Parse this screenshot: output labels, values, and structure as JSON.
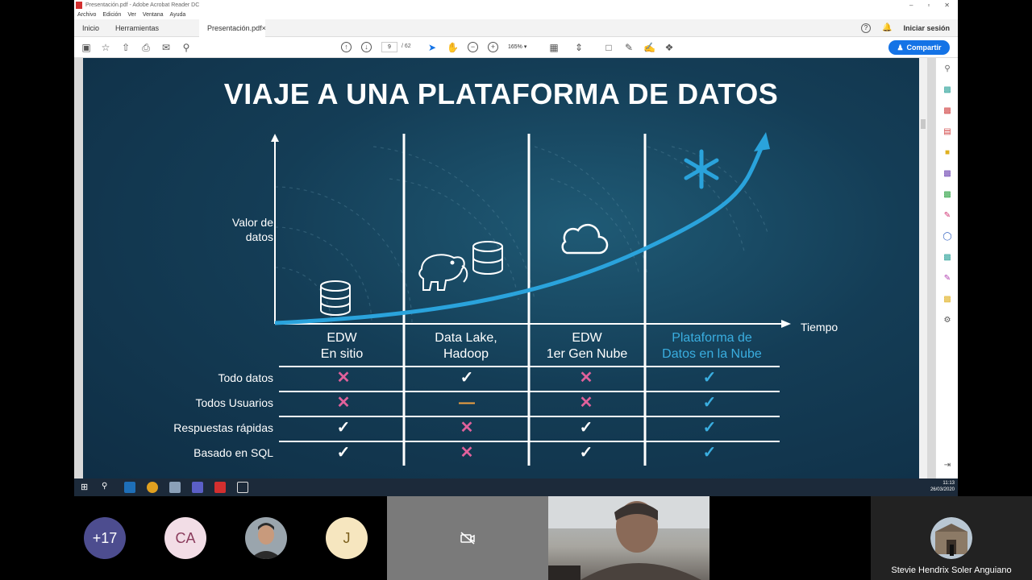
{
  "window": {
    "title": "Presentación.pdf - Adobe Acrobat Reader DC",
    "menu": [
      "Archivo",
      "Edición",
      "Ver",
      "Ventana",
      "Ayuda"
    ],
    "controls": [
      "–",
      "▫",
      "✕"
    ]
  },
  "tabs": {
    "home": "Inicio",
    "tools": "Herramientas",
    "document": "Presentación.pdf",
    "close": "×",
    "help": "?",
    "signin": "Iniciar sesión"
  },
  "toolbar": {
    "page_current": "9",
    "page_total": "/ 62",
    "zoom": "165%",
    "share": "Compartir"
  },
  "slide": {
    "title": "VIAJE A UNA PLATAFORMA DE DATOS",
    "y_axis": "Valor de datos",
    "x_axis": "Tiempo",
    "columns": [
      {
        "line1": "EDW",
        "line2": "En sitio"
      },
      {
        "line1": "Data Lake,",
        "line2": "Hadoop"
      },
      {
        "line1": "EDW",
        "line2": "1er Gen Nube"
      },
      {
        "line1": "Plataforma de",
        "line2": "Datos en la Nube"
      }
    ],
    "rows": [
      "Todo datos",
      "Todos Usuarios",
      "Respuestas rápidas",
      "Basado en SQL"
    ],
    "matrix": [
      [
        "cross",
        "check",
        "cross",
        "check-blue"
      ],
      [
        "cross",
        "dash",
        "cross",
        "check-blue"
      ],
      [
        "check",
        "cross",
        "check",
        "check-blue"
      ],
      [
        "check",
        "cross",
        "check",
        "check-blue"
      ]
    ],
    "colors": {
      "accent": "#3aaee0",
      "cross": "#e0619b",
      "dash": "#f0a040"
    }
  },
  "taskbar": {
    "time": "11:13",
    "date": "26/03/2020"
  },
  "meeting": {
    "participants": [
      {
        "label": "+17",
        "color": "#4d4d8f",
        "text_color": "#ffffff"
      },
      {
        "label": "CA",
        "color": "#f2dde6",
        "text_color": "#8a3b5c"
      },
      {
        "label": "",
        "color": "#7b8794",
        "text_color": "#ffffff"
      },
      {
        "label": "J",
        "color": "#f6e6bf",
        "text_color": "#7a5d1a"
      }
    ],
    "name_label": "Stevie Hendrix Soler Anguiano"
  }
}
